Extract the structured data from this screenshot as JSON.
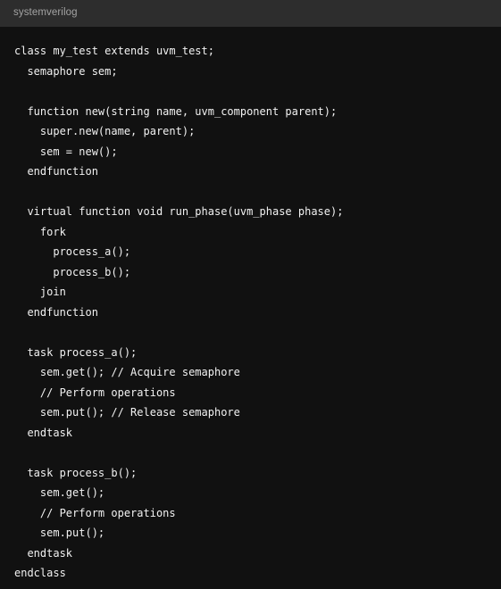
{
  "code_block": {
    "header": {
      "language_label": "systemverilog"
    },
    "colors": {
      "header_background": "#2d2d2d",
      "header_text": "#a3a3a3",
      "code_background": "#111111",
      "code_text": "#f2f2f2"
    },
    "code": {
      "language": "systemverilog",
      "line_count": 27,
      "lines": [
        "class my_test extends uvm_test;",
        "  semaphore sem;",
        "",
        "  function new(string name, uvm_component parent);",
        "    super.new(name, parent);",
        "    sem = new();",
        "  endfunction",
        "",
        "  virtual function void run_phase(uvm_phase phase);",
        "    fork",
        "      process_a();",
        "      process_b();",
        "    join",
        "  endfunction",
        "",
        "  task process_a();",
        "    sem.get(); // Acquire semaphore",
        "    // Perform operations",
        "    sem.put(); // Release semaphore",
        "  endtask",
        "",
        "  task process_b();",
        "    sem.get();",
        "    // Perform operations",
        "    sem.put();",
        "  endtask",
        "endclass"
      ],
      "full_text": "class my_test extends uvm_test;\n  semaphore sem;\n\n  function new(string name, uvm_component parent);\n    super.new(name, parent);\n    sem = new();\n  endfunction\n\n  virtual function void run_phase(uvm_phase phase);\n    fork\n      process_a();\n      process_b();\n    join\n  endfunction\n\n  task process_a();\n    sem.get(); // Acquire semaphore\n    // Perform operations\n    sem.put(); // Release semaphore\n  endtask\n\n  task process_b();\n    sem.get();\n    // Perform operations\n    sem.put();\n  endtask\nendclass"
    }
  }
}
